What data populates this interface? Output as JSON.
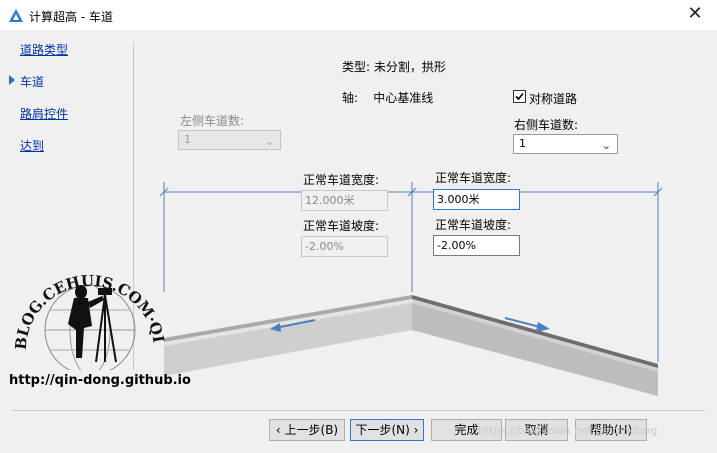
{
  "window": {
    "title": "计算超高 - 车道"
  },
  "nav": {
    "items": [
      {
        "label": "道路类型"
      },
      {
        "label": "车道"
      },
      {
        "label": "路肩控件"
      },
      {
        "label": "达到"
      }
    ]
  },
  "info": {
    "type_text": "类型: 未分割，拱形",
    "axis_text": "轴:    中心基准线"
  },
  "symmetric": {
    "label": "对称道路",
    "checked": true
  },
  "left": {
    "lane_count_label": "左侧车道数:",
    "lane_count_value": "1",
    "lane_width_label": "正常车道宽度:",
    "lane_width_value": "12.000米",
    "lane_slope_label": "正常车道坡度:",
    "lane_slope_value": "-2.00%"
  },
  "right": {
    "lane_count_label": "右侧车道数:",
    "lane_count_value": "1",
    "lane_width_label": "正常车道宽度:",
    "lane_width_value": "3.000米",
    "lane_slope_label": "正常车道坡度:",
    "lane_slope_value": "-2.00%"
  },
  "buttons": {
    "back": "上一步(B)",
    "next": "下一步(N)",
    "finish": "完成",
    "cancel": "取消",
    "help": "帮助(H)"
  },
  "watermark": {
    "ring_text": "BLOG.CEHUIS.COM·QINDONG",
    "url": "http://qin-dong.github.io",
    "csdn": "https://blog.csdn.net/qinqindong"
  },
  "colors": {
    "accent": "#2b78d4",
    "link": "#0033aa",
    "dimension_line": "#4a7fc1"
  }
}
